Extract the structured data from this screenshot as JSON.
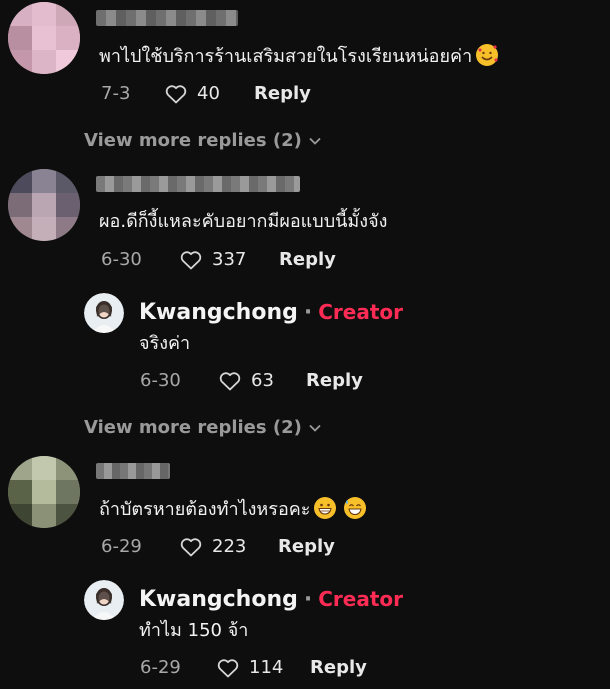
{
  "comments": [
    {
      "text": "พาไปใช้บริการร้านเสริมสวยในโรงเรียนหน่อยค่า",
      "emoji": "smiling-face-with-hearts",
      "date": "7-3",
      "likes": "40",
      "reply_label": "Reply",
      "view_more": "View more replies (2)"
    },
    {
      "text": "ผอ.ดีก็งี้แหละคับอยากมีผอแบบนี้มั้งจัง",
      "date": "6-30",
      "likes": "337",
      "reply_label": "Reply",
      "creator_reply": {
        "name": "Kwangchong",
        "separator": "·",
        "badge": "Creator",
        "text": "จริงค่า",
        "date": "6-30",
        "likes": "63",
        "reply_label": "Reply"
      },
      "view_more": "View more replies (2)"
    },
    {
      "text": "ถ้าบัตรหายต้องทำไงหรอคะ",
      "emojis": [
        "grinning-face",
        "grinning-face-with-sweat"
      ],
      "date": "6-29",
      "likes": "223",
      "reply_label": "Reply",
      "creator_reply": {
        "name": "Kwangchong",
        "separator": "·",
        "badge": "Creator",
        "text": "ทำไม 150 จ้า",
        "date": "6-29",
        "likes": "114",
        "reply_label": "Reply"
      }
    }
  ],
  "colors": {
    "background": "#0e0e0e",
    "creator_badge": "#fe2c55",
    "muted_text": "#a8a8a8"
  }
}
